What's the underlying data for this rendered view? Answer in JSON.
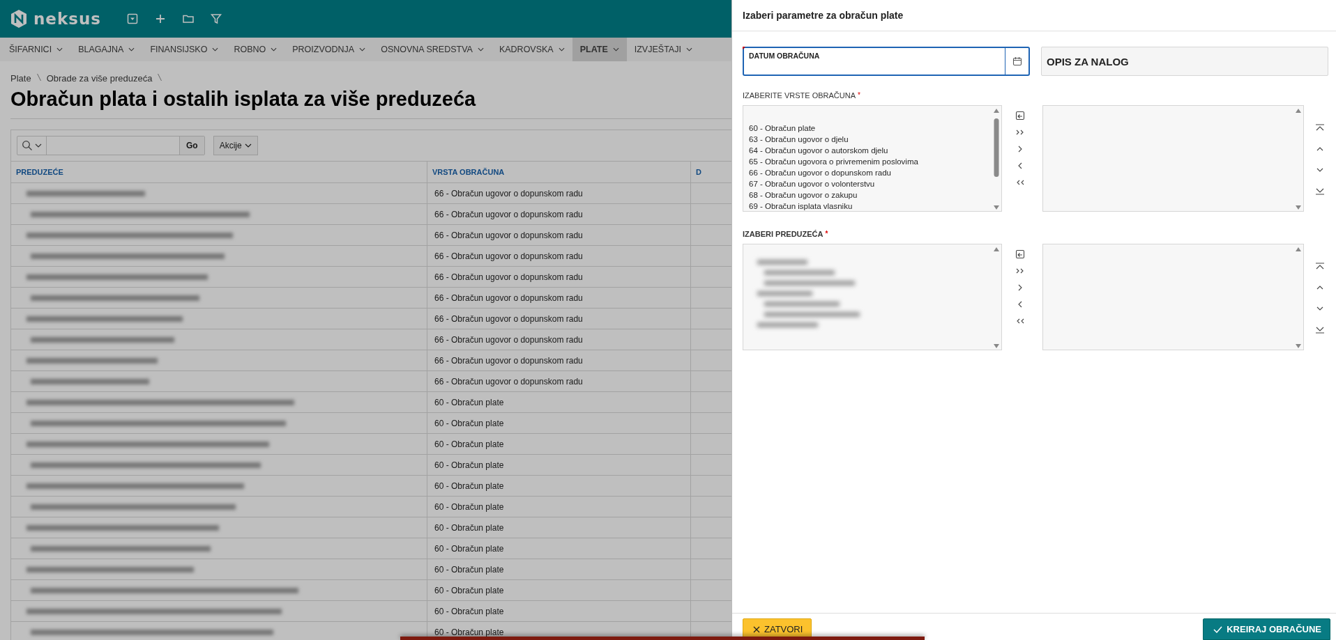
{
  "brand": {
    "name": "neksus"
  },
  "nav": [
    {
      "label": "ŠIFARNICI",
      "selected": false
    },
    {
      "label": "BLAGAJNA",
      "selected": false
    },
    {
      "label": "FINANSIJSKO",
      "selected": false
    },
    {
      "label": "ROBNO",
      "selected": false
    },
    {
      "label": "PROIZVODNJA",
      "selected": false
    },
    {
      "label": "OSNOVNA SREDSTVA",
      "selected": false
    },
    {
      "label": "KADROVSKA",
      "selected": false
    },
    {
      "label": "PLATE",
      "selected": true
    },
    {
      "label": "IZVJEŠTAJI",
      "selected": false
    }
  ],
  "breadcrumb": [
    "Plate",
    "Obrade za više preduzeća"
  ],
  "page_title": "Obračun plata i ostalih isplata za više preduzeća",
  "report": {
    "go_label": "Go",
    "actions_label": "Akcije",
    "columns": [
      "PREDUZEĆE",
      "VRSTA OBRAČUNA",
      "D"
    ],
    "rows": [
      {
        "column_2": "66 - Obračun ugovor o dopunskom radu"
      },
      {
        "column_2": "66 - Obračun ugovor o dopunskom radu"
      },
      {
        "column_2": "66 - Obračun ugovor o dopunskom radu"
      },
      {
        "column_2": "66 - Obračun ugovor o dopunskom radu"
      },
      {
        "column_2": "66 - Obračun ugovor o dopunskom radu"
      },
      {
        "column_2": "66 - Obračun ugovor o dopunskom radu"
      },
      {
        "column_2": "66 - Obračun ugovor o dopunskom radu"
      },
      {
        "column_2": "66 - Obračun ugovor o dopunskom radu"
      },
      {
        "column_2": "66 - Obračun ugovor o dopunskom radu"
      },
      {
        "column_2": "66 - Obračun ugovor o dopunskom radu"
      },
      {
        "column_2": "60 - Obračun plate"
      },
      {
        "column_2": "60 - Obračun plate"
      },
      {
        "column_2": "60 - Obračun plate"
      },
      {
        "column_2": "60 - Obračun plate"
      },
      {
        "column_2": "60 - Obračun plate"
      },
      {
        "column_2": "60 - Obračun plate"
      },
      {
        "column_2": "60 - Obračun plate"
      },
      {
        "column_2": "60 - Obračun plate"
      },
      {
        "column_2": "60 - Obračun plate"
      },
      {
        "column_2": "60 - Obračun plate"
      },
      {
        "column_2": "60 - Obračun plate"
      },
      {
        "column_2": "60 - Obračun plate"
      }
    ]
  },
  "dialog": {
    "title": "Izaberi parametre za obračun plate",
    "fields": [
      {
        "kind": "date",
        "label": "DATUM OBRAČUNA",
        "focused": true
      },
      {
        "kind": "text",
        "label": "OPIS ZA NALOG",
        "focused": false
      }
    ],
    "shuttles": [
      {
        "label": "IZABERITE VRSTE OBRAČUNA",
        "mark": "*",
        "blurred": false,
        "options": [
          "60 - Obračun plate",
          "63 - Obračun ugovor o djelu",
          "64 - Obračun ugovor o autorskom djelu",
          "65 - Obračun ugovora o privremenim poslovima",
          "66 - Obračun ugovor o dopunskom radu",
          "67 - Obračun ugovor o volonterstvu",
          "68 - Obračun ugovor o zakupu",
          "69 - Obračun isplata vlasniku"
        ]
      },
      {
        "label": "IZABERI PREDUZEĆA",
        "mark": "*",
        "blurred": true
      }
    ],
    "buttons": [
      {
        "kind": "cancel",
        "label": "ZATVORI"
      },
      {
        "kind": "confirm",
        "label": "KREIRAJ OBRAČUNE"
      }
    ]
  }
}
